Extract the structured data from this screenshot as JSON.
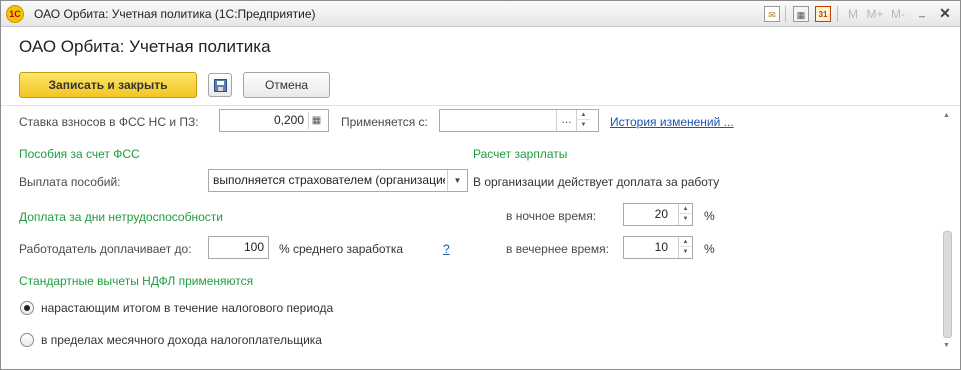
{
  "window": {
    "app_logo": "1С",
    "title": "ОАО Орбита: Учетная политика   (1С:Предприятие)",
    "toolbar": {
      "calendar_day": "31",
      "mem_m": "M",
      "mem_plus": "M+",
      "mem_minus": "M-"
    },
    "controls": {
      "minimize": "_",
      "close": "✕"
    }
  },
  "header": {
    "title": "ОАО Орбита: Учетная политика",
    "save_close_label": "Записать и закрыть",
    "cancel_label": "Отмена"
  },
  "form": {
    "fss_rate": {
      "label": "Ставка взносов в ФСС НС и ПЗ:",
      "value": "0,200"
    },
    "applies_from": {
      "label": "Применяется с:",
      "value": "",
      "dots": "..."
    },
    "history_link": "История изменений ...",
    "benefits": {
      "section_title": "Пособия за счет ФСС",
      "payment_label": "Выплата пособий:",
      "payment_value": "выполняется страхователем (организацией)"
    },
    "payroll": {
      "section_title": "Расчет зарплаты",
      "extra_pay_note": "В организации действует доплата за работу",
      "night_label": "в ночное время:",
      "night_value": "20",
      "evening_label": "в вечернее время:",
      "evening_value": "10",
      "percent": "%"
    },
    "disability": {
      "section_title": "Доплата за дни нетрудоспособности",
      "employer_label": "Работодатель доплачивает до:",
      "employer_value": "100",
      "avg_earnings": "% среднего заработка",
      "help": "?"
    },
    "ndfl": {
      "section_title": "Стандартные вычеты НДФЛ применяются",
      "options": [
        {
          "label": "нарастающим итогом в течение налогового периода",
          "checked": true
        },
        {
          "label": "в пределах месячного дохода налогоплательщика",
          "checked": false
        }
      ]
    }
  }
}
